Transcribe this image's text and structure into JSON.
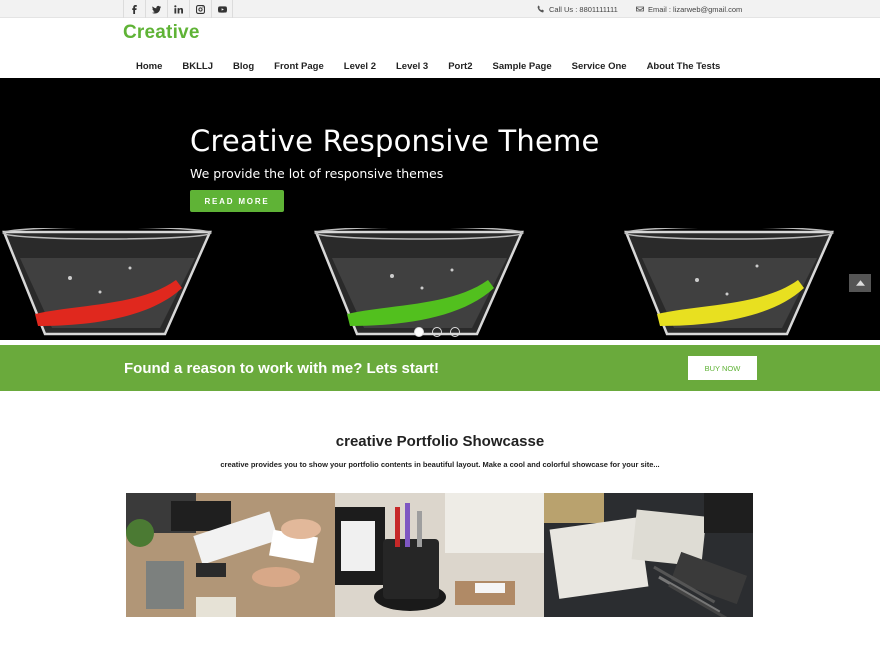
{
  "topbar": {
    "social_icons": [
      "facebook-icon",
      "twitter-icon",
      "linkedin-icon",
      "instagram-icon",
      "youtube-icon"
    ],
    "call": "Call Us : 8801111111",
    "email": "Email : lizarweb@gmail.com"
  },
  "header": {
    "logo": "Creative",
    "logo_color": "#5fb336",
    "nav": [
      "Home",
      "BKLLJ",
      "Blog",
      "Front Page",
      "Level 2",
      "Level 3",
      "Port2",
      "Sample Page",
      "Service One",
      "About The Tests"
    ]
  },
  "hero": {
    "title": "Creative Responsive Theme",
    "subtitle": "We provide the lot of responsive themes",
    "button": "READ MORE",
    "slides": 3,
    "active_slide": 1
  },
  "cta": {
    "text": "Found a reason to work with me? Lets start!",
    "button": "BUY NOW",
    "band_color": "#6aaa3c"
  },
  "portfolio": {
    "title": "creative Portfolio Showcasse",
    "description": "creative provides you to show your portfolio contents in beautiful layout. Make a cool and colorful showcase for your site..."
  }
}
